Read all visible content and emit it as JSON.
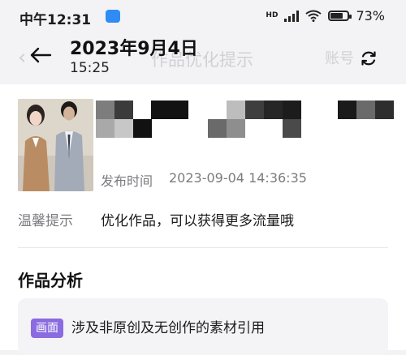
{
  "status_bar": {
    "time": "中午12:31",
    "network": "HD",
    "battery": "73%",
    "battery_level": 0.73
  },
  "header": {
    "date": "2023年9月4日",
    "time": "15:25",
    "underlying_title": "作品优化提示",
    "underlying_right": "账号"
  },
  "post": {
    "publish_label": "发布时间",
    "publish_time": "2023-09-04 14:36:35"
  },
  "tip": {
    "label": "温馨提示",
    "text": "优化作品，可以获得更多流量哦"
  },
  "analysis": {
    "section_title": "作品分析",
    "tag": "画面",
    "text": "涉及非原创及无创作的素材引用"
  },
  "colors": {
    "accent_tag": "#8a6be0",
    "status_icon": "#2f8cf5"
  },
  "icons": {
    "back": "arrow-left-icon",
    "sync": "sync-icon",
    "signal": "signal-icon",
    "wifi": "wifi-icon",
    "battery": "battery-icon"
  }
}
